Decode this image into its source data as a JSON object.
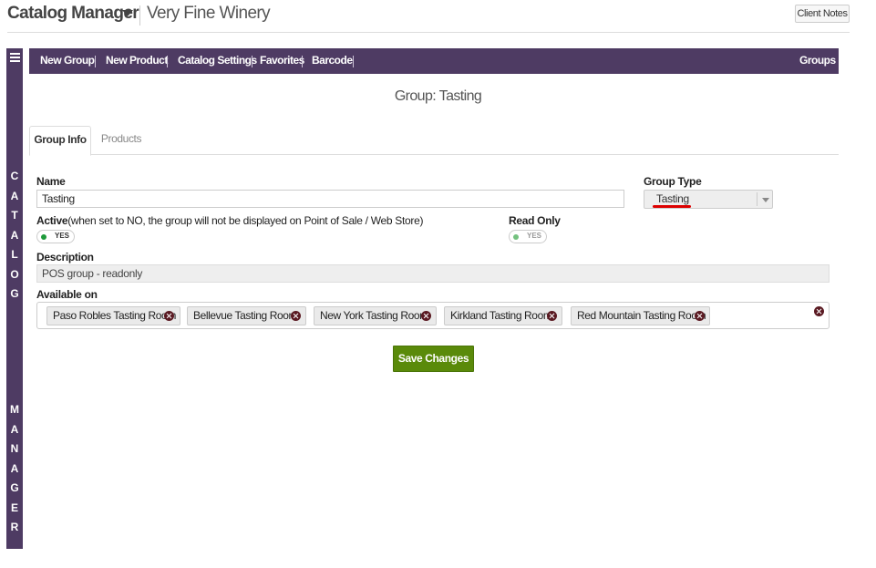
{
  "header": {
    "app_title": "Catalog Manager",
    "company": "Very Fine Winery",
    "client_notes_label": "Client Notes"
  },
  "sidebar": {
    "label_top": "CATALOG",
    "label_bottom": "MANAGER"
  },
  "navbar": {
    "items": [
      {
        "label": "New Group"
      },
      {
        "label": "New Product"
      },
      {
        "label": "Catalog Settings"
      },
      {
        "label": "Favorites"
      },
      {
        "label": "Barcode"
      }
    ],
    "right_item": "Groups"
  },
  "page_title": "Group: Tasting",
  "tabs": [
    {
      "label": "Group Info",
      "active": true
    },
    {
      "label": "Products",
      "active": false
    }
  ],
  "form": {
    "name_label": "Name",
    "name_value": "Tasting",
    "group_type_label": "Group Type",
    "group_type_value": "Tasting",
    "active_label": "Active",
    "active_note": "(when set to NO, the group will not be displayed on Point of Sale / Web Store)",
    "active_value": "YES",
    "read_only_label": "Read Only",
    "read_only_value": "YES",
    "description_label": "Description",
    "description_value": "POS group - readonly",
    "available_on_label": "Available on",
    "available_on": [
      "Paso Robles Tasting Room",
      "Bellevue Tasting Room",
      "New York Tasting Room",
      "Kirkland Tasting Room",
      "Red Mountain Tasting Room"
    ],
    "save_label": "Save Changes"
  },
  "colors": {
    "brand_purple": "#4e3b63",
    "save_green": "#5a8a0a",
    "toggle_on": "#1e9a3a",
    "remove_icon": "#5a1a22",
    "highlight_red": "#d00000"
  }
}
